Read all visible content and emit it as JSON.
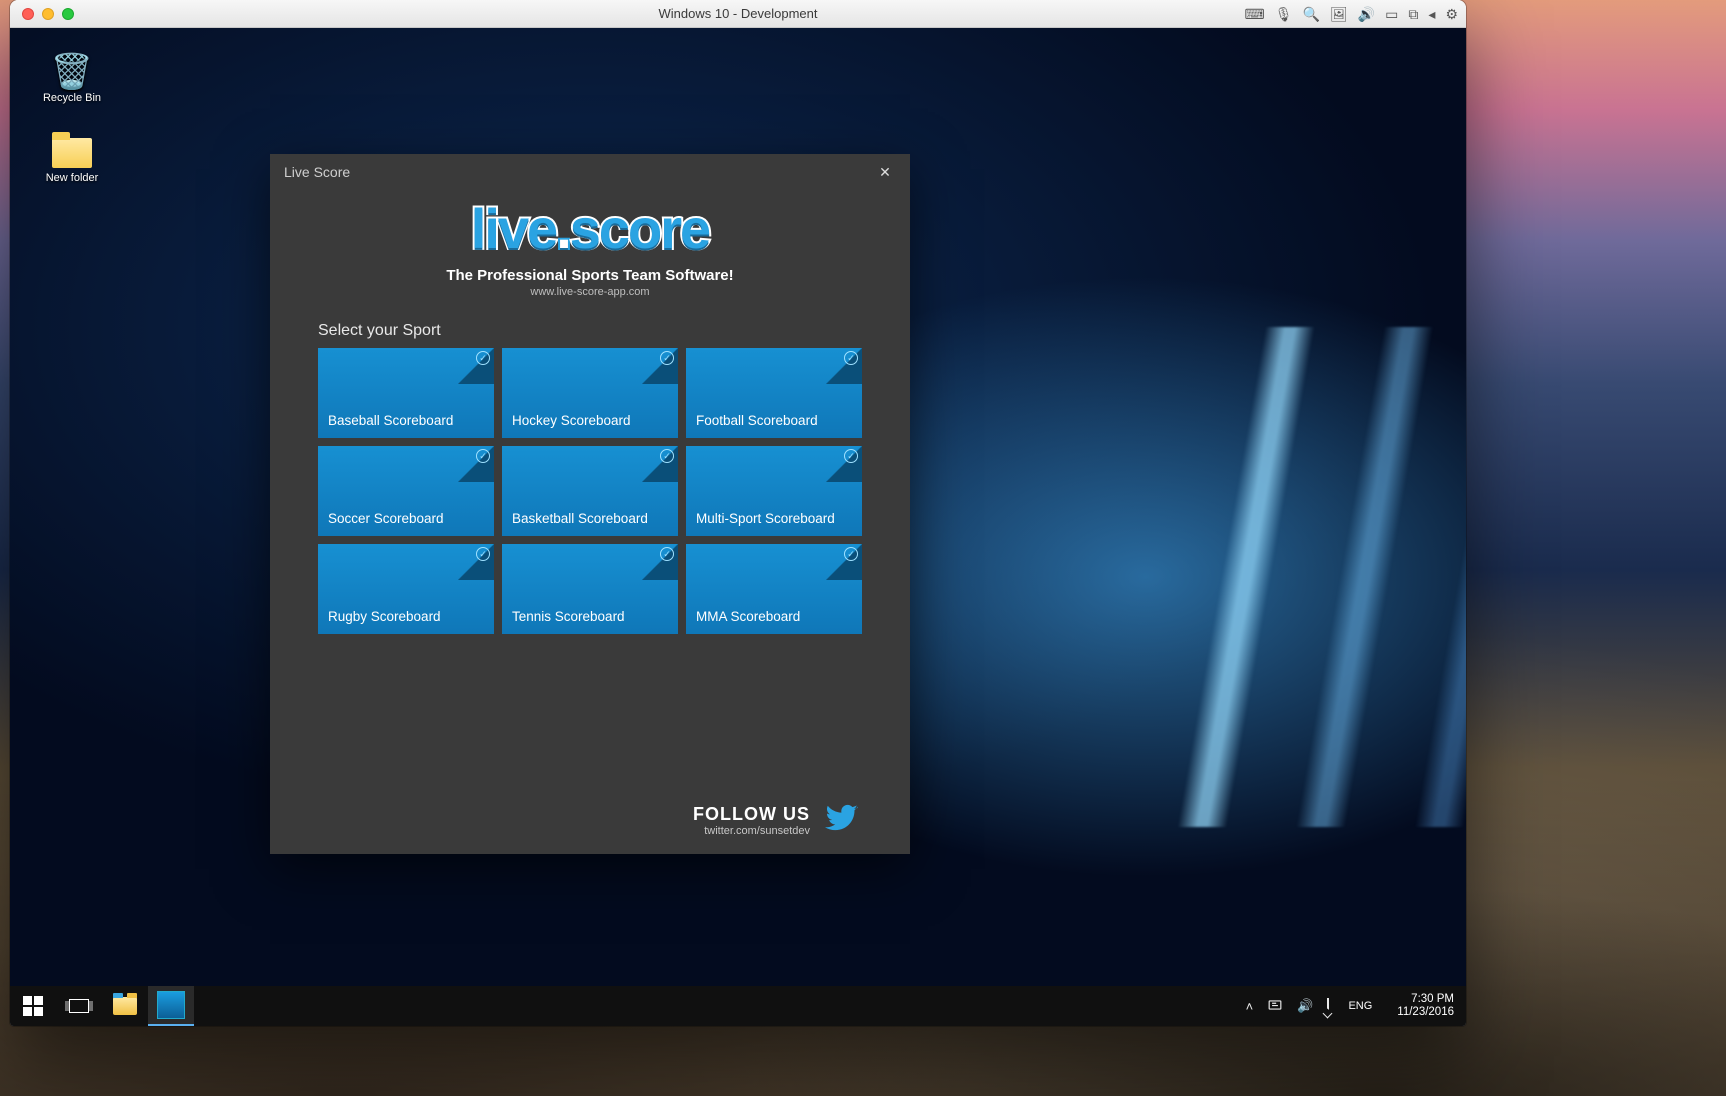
{
  "mac": {
    "window_title": "Windows 10 - Development",
    "toolbar_icons": [
      "keyboard-icon",
      "mic-icon",
      "search-icon",
      "camera-icon",
      "volume-icon",
      "tablet-icon",
      "pip-icon",
      "back-icon",
      "gear-icon"
    ]
  },
  "desktop": {
    "icons": [
      {
        "name": "recycle-bin-icon",
        "label": "Recycle Bin"
      },
      {
        "name": "new-folder-icon",
        "label": "New folder"
      }
    ]
  },
  "app": {
    "title": "Live Score",
    "logo_left": "live",
    "logo_dot": ".",
    "logo_right": "score",
    "tagline": "The Professional Sports Team Software!",
    "site": "www.live-score-app.com",
    "select_label": "Select your Sport",
    "tiles": [
      "Baseball Scoreboard",
      "Hockey Scoreboard",
      "Football Scoreboard",
      "Soccer Scoreboard",
      "Basketball Scoreboard",
      "Multi-Sport Scoreboard",
      "Rugby Scoreboard",
      "Tennis Scoreboard",
      "MMA Scoreboard"
    ],
    "follow_title": "FOLLOW US",
    "follow_handle": "twitter.com/sunsetdev"
  },
  "taskbar": {
    "tray_chevron": "˄",
    "lang": "ENG",
    "time": "7:30 PM",
    "date": "11/23/2016"
  }
}
